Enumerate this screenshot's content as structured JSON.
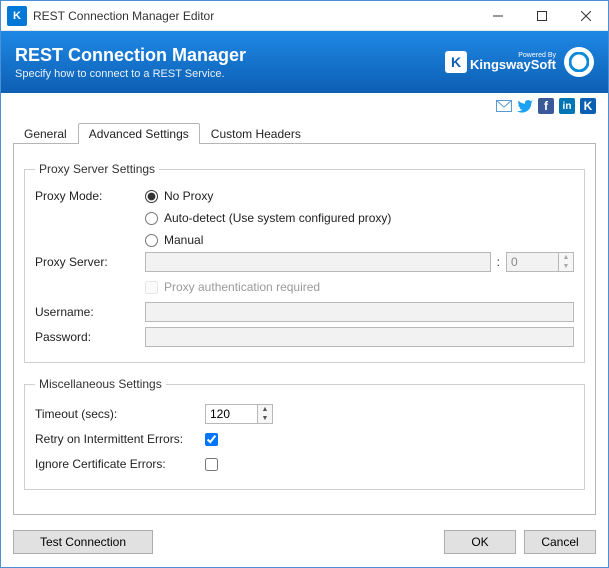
{
  "titlebar": {
    "icon_letter": "K",
    "title": "REST Connection Manager Editor"
  },
  "banner": {
    "title": "REST Connection Manager",
    "subtitle": "Specify how to connect to a REST Service.",
    "powered_by": "Powered By",
    "vendor": "KingswaySoft"
  },
  "tabs": {
    "general": "General",
    "advanced": "Advanced Settings",
    "custom_headers": "Custom Headers"
  },
  "proxy": {
    "legend": "Proxy Server Settings",
    "mode_label": "Proxy Mode:",
    "no_proxy": "No Proxy",
    "auto_detect": "Auto-detect (Use system configured proxy)",
    "manual": "Manual",
    "server_label": "Proxy Server:",
    "server_value": "",
    "port_value": "0",
    "auth_required": "Proxy authentication required",
    "username_label": "Username:",
    "username_value": "",
    "password_label": "Password:",
    "password_value": ""
  },
  "misc": {
    "legend": "Miscellaneous Settings",
    "timeout_label": "Timeout (secs):",
    "timeout_value": "120",
    "retry_label": "Retry on Intermittent Errors:",
    "ignore_cert_label": "Ignore Certificate Errors:"
  },
  "buttons": {
    "test": "Test Connection",
    "ok": "OK",
    "cancel": "Cancel"
  }
}
